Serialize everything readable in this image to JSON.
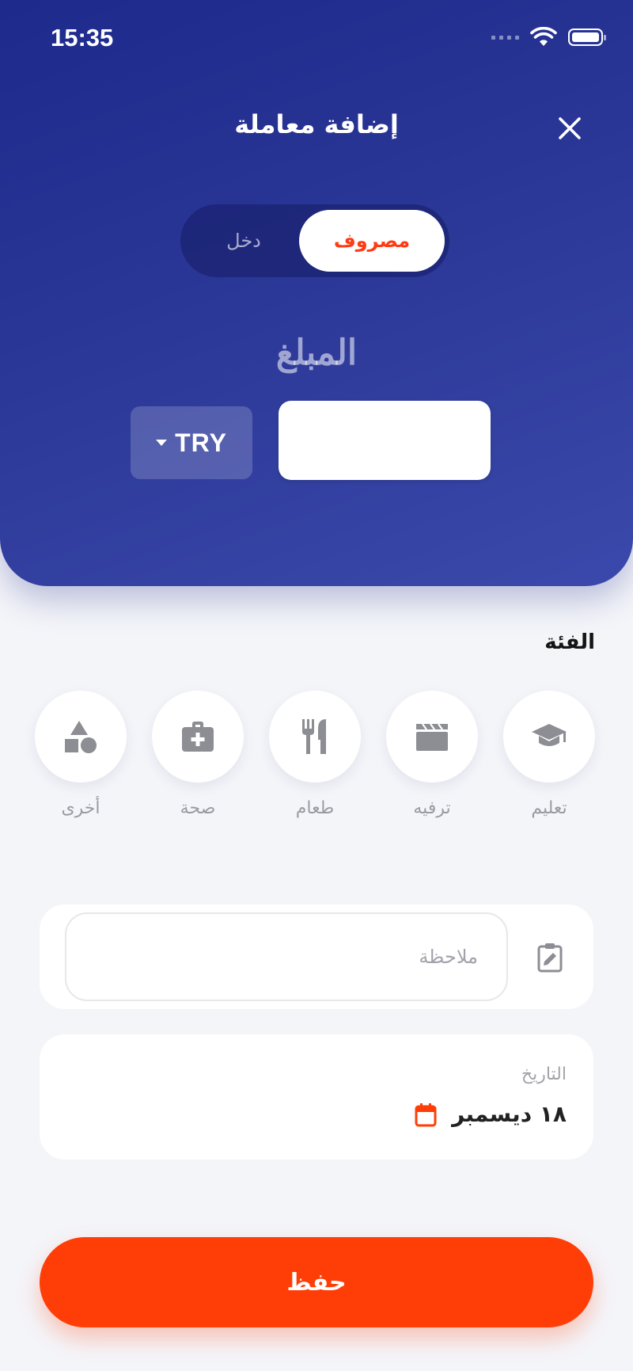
{
  "status_bar": {
    "time": "15:35"
  },
  "header": {
    "title": "إضافة معاملة"
  },
  "type_toggle": {
    "active": "مصروف",
    "inactive": "دخل"
  },
  "amount": {
    "label": "المبلغ",
    "currency": "TRY",
    "value": ""
  },
  "category": {
    "label": "الفئة",
    "items": [
      {
        "label": "تعليم",
        "icon": "graduation-cap-icon"
      },
      {
        "label": "ترفيه",
        "icon": "clapperboard-icon"
      },
      {
        "label": "طعام",
        "icon": "fork-knife-icon"
      },
      {
        "label": "صحة",
        "icon": "medical-kit-icon"
      },
      {
        "label": "أخرى",
        "icon": "shapes-icon"
      }
    ]
  },
  "note": {
    "placeholder": "ملاحظة"
  },
  "date": {
    "label": "التاريخ",
    "value": "١٨ ديسمبر"
  },
  "save": {
    "label": "حفظ"
  },
  "colors": {
    "accent": "#ff3d07",
    "header": "#2b3796",
    "icon_gray": "#8d8d94"
  }
}
